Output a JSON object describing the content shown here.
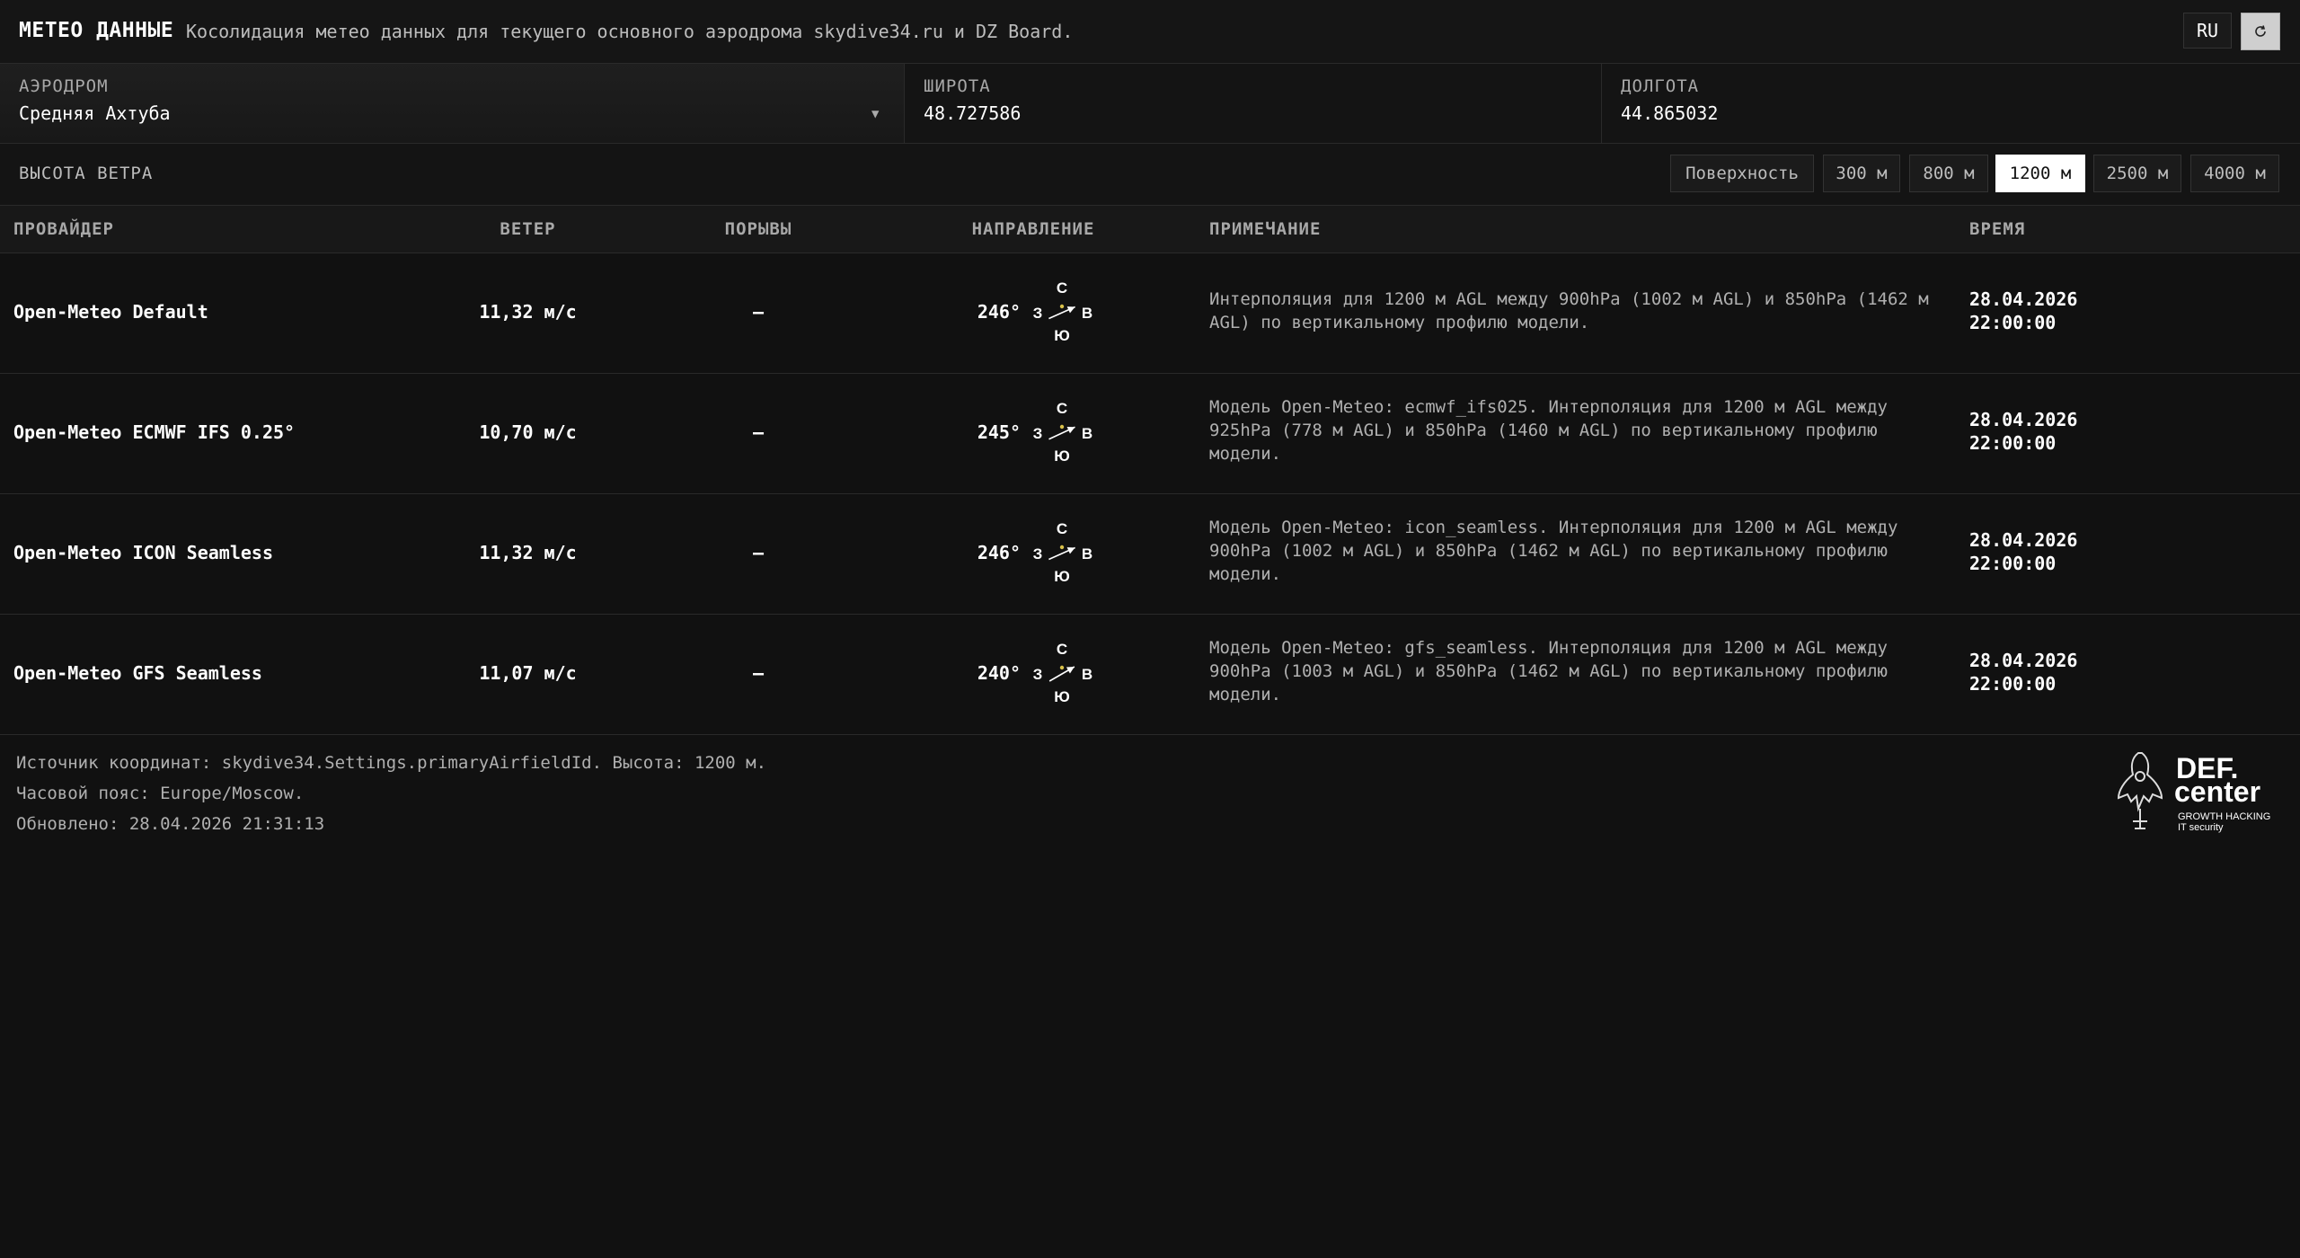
{
  "header": {
    "title": "МЕТЕО ДАННЫЕ",
    "subtitle": "Косолидация метео данных для текущего основного аэродрома skydive34.ru и DZ Board.",
    "lang": "RU",
    "refresh_icon": "refresh-icon"
  },
  "fields": {
    "airfield": {
      "label": "АЭРОДРОМ",
      "value": "Средняя Ахтуба"
    },
    "latitude": {
      "label": "ШИРОТА",
      "value": "48.727586"
    },
    "longitude": {
      "label": "ДОЛГОТА",
      "value": "44.865032"
    }
  },
  "wind_altitude": {
    "label": "ВЫСОТА ВЕТРА",
    "options": [
      "Поверхность",
      "300 м",
      "800 м",
      "1200 м",
      "2500 м",
      "4000 м"
    ],
    "selected": "1200 м"
  },
  "table": {
    "headers": [
      "ПРОВАЙДЕР",
      "ВЕТЕР",
      "ПОРЫВЫ",
      "НАПРАВЛЕНИЕ",
      "ПРИМЕЧАНИЕ",
      "ВРЕМЯ"
    ],
    "compass_labels": {
      "n": "С",
      "s": "Ю",
      "w": "З",
      "e": "В"
    },
    "rows": [
      {
        "provider": "Open-Meteo Default",
        "wind": "11,32 м/с",
        "gusts": "—",
        "direction": "246°",
        "direction_deg": 246,
        "note": "Интерполяция для 1200 м AGL между 900hPa (1002 м AGL) и 850hPa (1462 м AGL) по вертикальному профилю модели.",
        "date": "28.04.2026",
        "time": "22:00:00"
      },
      {
        "provider": "Open-Meteo ECMWF IFS 0.25°",
        "wind": "10,70 м/с",
        "gusts": "—",
        "direction": "245°",
        "direction_deg": 245,
        "note": "Модель Open-Meteo: ecmwf_ifs025. Интерполяция для 1200 м AGL между 925hPa (778 м AGL) и 850hPa (1460 м AGL) по вертикальному профилю модели.",
        "date": "28.04.2026",
        "time": "22:00:00"
      },
      {
        "provider": "Open-Meteo ICON Seamless",
        "wind": "11,32 м/с",
        "gusts": "—",
        "direction": "246°",
        "direction_deg": 246,
        "note": "Модель Open-Meteo: icon_seamless. Интерполяция для 1200 м AGL между 900hPa (1002 м AGL) и 850hPa (1462 м AGL) по вертикальному профилю модели.",
        "date": "28.04.2026",
        "time": "22:00:00"
      },
      {
        "provider": "Open-Meteo GFS Seamless",
        "wind": "11,07 м/с",
        "gusts": "—",
        "direction": "240°",
        "direction_deg": 240,
        "note": "Модель Open-Meteo: gfs_seamless. Интерполяция для 1200 м AGL между 900hPa (1003 м AGL) и 850hPa (1462 м AGL) по вертикальному профилю модели.",
        "date": "28.04.2026",
        "time": "22:00:00"
      }
    ]
  },
  "footer": {
    "source": "Источник координат: skydive34.Settings.primaryAirfieldId. Высота: 1200 м.",
    "timezone": "Часовой пояс: Europe/Moscow.",
    "updated": "Обновлено: 28.04.2026 21:31:13"
  },
  "logo": {
    "name": "DEF.center",
    "line1": "DEF.",
    "line2": "center",
    "tagline1": "GROWTH HACKING",
    "tagline2": "IT security"
  }
}
